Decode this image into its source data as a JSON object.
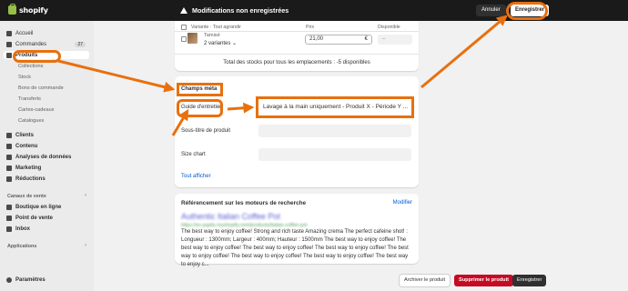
{
  "topbar": {
    "logo_text": "shopify",
    "unsaved_text": "Modifications non enregistrées",
    "cancel_label": "Annuler",
    "save_label": "Enregistrer"
  },
  "sidebar": {
    "items": [
      {
        "label": "Accueil"
      },
      {
        "label": "Commandes",
        "count": "27"
      },
      {
        "label": "Produits"
      },
      {
        "label": "Collections"
      },
      {
        "label": "Stock"
      },
      {
        "label": "Bons de commande"
      },
      {
        "label": "Transferts"
      },
      {
        "label": "Cartes-cadeaux"
      },
      {
        "label": "Catalogues"
      },
      {
        "label": "Clients"
      },
      {
        "label": "Contenu"
      },
      {
        "label": "Analyses de données"
      },
      {
        "label": "Marketing"
      },
      {
        "label": "Réductions"
      }
    ],
    "sales_channels_heading": "Canaux de vente",
    "channels": [
      {
        "label": "Boutique en ligne"
      },
      {
        "label": "Point de vente"
      },
      {
        "label": "Inbox"
      }
    ],
    "apps_heading": "Applications",
    "settings_label": "Paramètres"
  },
  "variants": {
    "header_variant": "Variante · Tout agrandir",
    "header_price": "Prix",
    "header_available": "Disponible",
    "row_name": "Tamisé",
    "row_sub": "2 variantes",
    "price_value": "21,00",
    "currency": "€",
    "available_value": "–",
    "stock_total": "Total des stocks pour tous les emplacements : -5 disponibles"
  },
  "metafields": {
    "title": "Champs méta",
    "rows": [
      {
        "label": "Guide d'entretien",
        "value": "Lavage à la main uniquement - Produit X - Période Y ..."
      },
      {
        "label": "Sous-titre de produit",
        "value": ""
      },
      {
        "label": "Size chart",
        "value": ""
      }
    ],
    "show_all": "Tout afficher"
  },
  "seo": {
    "title": "Référencement sur les moteurs de recherche",
    "edit_label": "Modifier",
    "preview_title": "Authentic Italian Coffee Pot",
    "preview_url": "https://ex-paplis.myshopify.com/products/italian-coffee-pot",
    "description": "The best way to enjoy coffee! Strong and rich taste Amazing crema The perfect cafeine shot! : Longueur : 1300mm; Largeur : 400mm; Hauteur : 1500mm The best way to enjoy coffee! The best way to enjoy coffee! The best way to enjoy coffee! The best way to enjoy coffee! The best way to enjoy coffee! The best way to enjoy coffee! The best way to enjoy coffee! The best way to enjoy c..."
  },
  "footer": {
    "archive_label": "Archiver le produit",
    "delete_label": "Supprimer le produit",
    "save_label": "Enregistrer"
  },
  "colors": {
    "annotation": "#e8700f",
    "danger": "#c70a24",
    "link": "#005bd3"
  }
}
